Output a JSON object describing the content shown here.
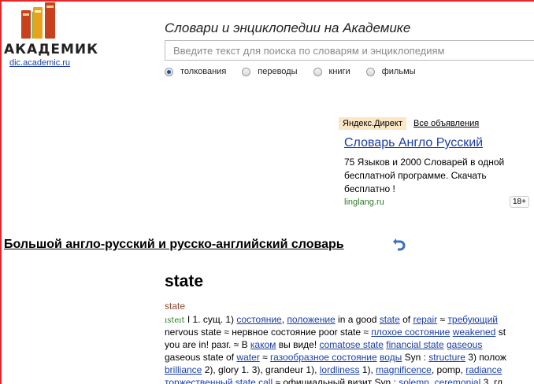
{
  "logo": {
    "name": "АКАДЕМИК",
    "link": "dic.academic.ru"
  },
  "search": {
    "title": "Словари и энциклопедии на Академике",
    "placeholder": "Введите текст для поиска по словарям и энциклопедиям",
    "options": [
      {
        "label": "толкования",
        "checked": true
      },
      {
        "label": "переводы",
        "checked": false
      },
      {
        "label": "книги",
        "checked": false
      },
      {
        "label": "фильмы",
        "checked": false
      }
    ]
  },
  "ad": {
    "badge": "Яндекс.Директ",
    "all_ads": "Все объявления",
    "title": "Словарь Англо Русский",
    "description": "75 Языков и 2000 Словарей в одной бесплатной программе. Скачать бесплатно !",
    "domain": "linglang.ru",
    "age": "18+"
  },
  "dictionary": {
    "title": "Большой англо-русский и русско-английский словарь",
    "headword": "state",
    "label": "state",
    "lines": [
      [
        {
          "t": "ısteıt",
          "k": "tr"
        },
        {
          "t": " I 1. сущ. 1) "
        },
        {
          "t": "состояние",
          "k": "link"
        },
        {
          "t": ", "
        },
        {
          "t": "положение",
          "k": "link"
        },
        {
          "t": " in a good "
        },
        {
          "t": "state",
          "k": "link"
        },
        {
          "t": " of "
        },
        {
          "t": "repair",
          "k": "link"
        },
        {
          "t": " ≈ "
        },
        {
          "t": "требующий",
          "k": "link"
        }
      ],
      [
        {
          "t": "nervous state ≈ нервное состояние poor state ≈ "
        },
        {
          "t": "плохое состояние",
          "k": "link"
        },
        {
          "t": " "
        },
        {
          "t": "weakened",
          "k": "link"
        },
        {
          "t": " st"
        }
      ],
      [
        {
          "t": "you are in! разг. ≈ В "
        },
        {
          "t": "каком",
          "k": "link"
        },
        {
          "t": " вы виде! "
        },
        {
          "t": "comatose state",
          "k": "link"
        },
        {
          "t": " "
        },
        {
          "t": "financial state",
          "k": "link"
        },
        {
          "t": " "
        },
        {
          "t": "gaseous",
          "k": "link"
        }
      ],
      [
        {
          "t": "gaseous state of "
        },
        {
          "t": "water",
          "k": "link"
        },
        {
          "t": " ≈ "
        },
        {
          "t": "газообразное состояние",
          "k": "link"
        },
        {
          "t": " "
        },
        {
          "t": "воды",
          "k": "link"
        },
        {
          "t": " Syn : "
        },
        {
          "t": "structure",
          "k": "link"
        },
        {
          "t": " 3) полож"
        }
      ],
      [
        {
          "t": "brilliance",
          "k": "link"
        },
        {
          "t": " 2), glory 1. 3), grandeur 1), "
        },
        {
          "t": "lordliness",
          "k": "link"
        },
        {
          "t": " 1), "
        },
        {
          "t": "magnificence",
          "k": "link"
        },
        {
          "t": ", pomp, "
        },
        {
          "t": "radiance",
          "k": "link"
        }
      ],
      [
        {
          "t": "торжественный",
          "k": "link"
        },
        {
          "t": " "
        },
        {
          "t": "state call",
          "k": "link"
        },
        {
          "t": " ≈ официальный визит Syn : "
        },
        {
          "t": "solemn",
          "k": "link"
        },
        {
          "t": ", "
        },
        {
          "t": "ceremonial",
          "k": "link"
        },
        {
          "t": " 3. гл"
        }
      ]
    ]
  },
  "colors": {
    "frame": "#e8262a",
    "link": "#1a3ea8",
    "ad_badge_bg": "#fbe7c6",
    "ad_domain": "#2a7a2a",
    "book1": "#c8401c",
    "book2": "#e8a21c",
    "book3": "#6aa833"
  }
}
